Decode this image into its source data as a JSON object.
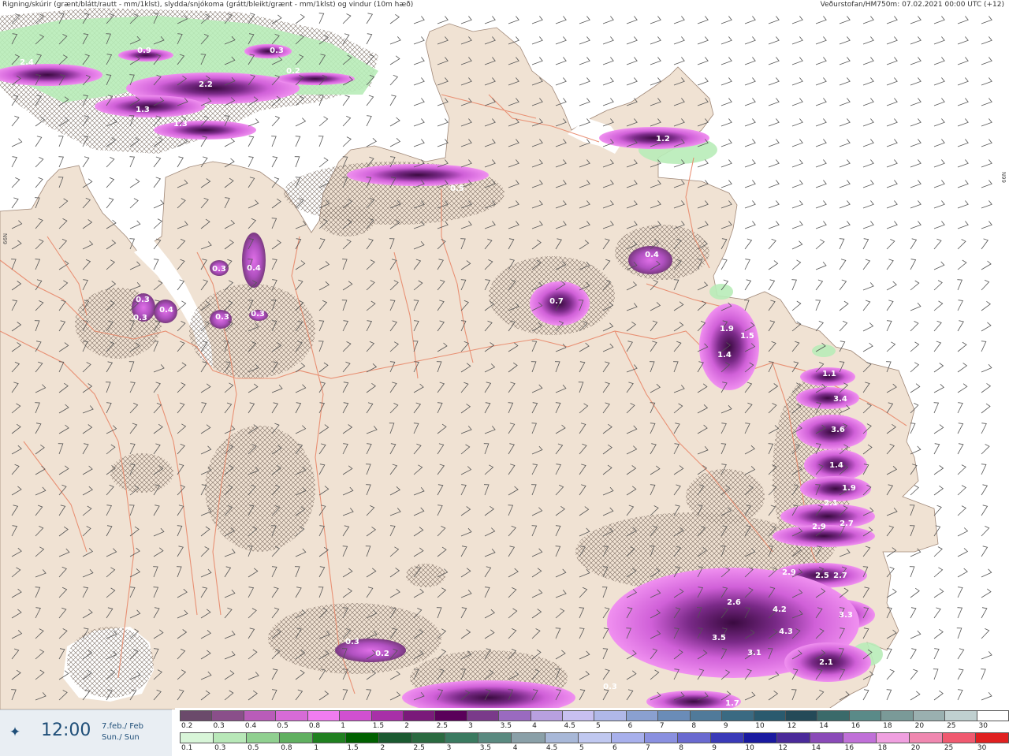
{
  "header": {
    "left_text": "Rigning/skúrir (grænt/blátt/rautt - mm/1klst), slydda/snjókoma (grátt/bleikt/grænt - mm/1klst) og vindur (10m hæð)",
    "right_text": "Veðurstofan/HM750m: 07.02.2021 00:00 UTC (+12)"
  },
  "latitude_markers": [
    "66N",
    "66N"
  ],
  "time_panel": {
    "icon": "compass-star-icon",
    "time": "12:00",
    "date_line1": "7.feb./ Feb",
    "date_line2": "Sun./ Sun"
  },
  "map": {
    "land_color": "#f0e2d3",
    "sea_color": "#ffffff",
    "road_color": "#e8886a",
    "precip_labels": [
      {
        "text": "2.4",
        "light": true
      },
      {
        "text": "0.9",
        "light": true
      },
      {
        "text": "0.3",
        "light": true
      },
      {
        "text": "0.2",
        "light": true
      },
      {
        "text": "2.2",
        "light": true
      },
      {
        "text": "1.3",
        "light": true
      },
      {
        "text": "1.3",
        "light": true
      },
      {
        "text": "0.5",
        "light": true
      },
      {
        "text": "1.2",
        "light": true
      },
      {
        "text": "0.3",
        "light": true
      },
      {
        "text": "0.4",
        "light": true
      },
      {
        "text": "0.3",
        "light": true
      },
      {
        "text": "0.4",
        "light": true
      },
      {
        "text": "0.3",
        "light": true
      },
      {
        "text": "0.3",
        "light": true
      },
      {
        "text": "0.3",
        "light": true
      },
      {
        "text": "0.4",
        "light": true
      },
      {
        "text": "0.7",
        "light": true
      },
      {
        "text": "1.9",
        "light": true
      },
      {
        "text": "1.5",
        "light": true
      },
      {
        "text": "1.4",
        "light": true
      },
      {
        "text": "1.1",
        "light": true
      },
      {
        "text": "3.4",
        "light": true
      },
      {
        "text": "3.6",
        "light": true
      },
      {
        "text": "1.4",
        "light": true
      },
      {
        "text": "1.9",
        "light": true
      },
      {
        "text": "2.1",
        "light": true
      },
      {
        "text": "2.9",
        "light": true
      },
      {
        "text": "2.7",
        "light": true
      },
      {
        "text": "2.9",
        "light": true
      },
      {
        "text": "2.5",
        "light": true
      },
      {
        "text": "2.7",
        "light": true
      },
      {
        "text": "2.6",
        "light": true
      },
      {
        "text": "4.2",
        "light": true
      },
      {
        "text": "3.3",
        "light": true
      },
      {
        "text": "3.5",
        "light": true
      },
      {
        "text": "4.3",
        "light": true
      },
      {
        "text": "3.1",
        "light": true
      },
      {
        "text": "2.1",
        "light": true
      },
      {
        "text": "0.3",
        "light": true
      },
      {
        "text": "0.2",
        "light": true
      },
      {
        "text": "0.3",
        "light": true
      },
      {
        "text": "1.7",
        "light": true
      }
    ]
  },
  "legend_rain": {
    "labels": [
      "0.2",
      "0.3",
      "0.4",
      "0.5",
      "0.8",
      "1",
      "1.5",
      "2",
      "2.5",
      "3",
      "3.5",
      "4",
      "4.5",
      "5",
      "6",
      "7",
      "8",
      "9",
      "10",
      "12",
      "14",
      "16",
      "18",
      "20",
      "25",
      "30"
    ],
    "colors": [
      "#6b4a6b",
      "#8a4f8a",
      "#b95cb9",
      "#d76bd7",
      "#f07cf0",
      "#d050d0",
      "#a830a8",
      "#7a1a7a",
      "#5a005a",
      "#7a3a8a",
      "#9a6ac0",
      "#b8a0e0",
      "#c8c0f0",
      "#b0b8e8",
      "#8aa0d0",
      "#6a8cb8",
      "#507a9a",
      "#3a6a82",
      "#2a5a6e",
      "#244a58",
      "#3a6a6a",
      "#5a8a88",
      "#7a9a98",
      "#9ab0b0",
      "#c0d0d0",
      "#ffffff"
    ]
  },
  "legend_snow": {
    "labels": [
      "0.1",
      "0.3",
      "0.5",
      "0.8",
      "1",
      "1.5",
      "2",
      "2.5",
      "3",
      "3.5",
      "4",
      "4.5",
      "5",
      "6",
      "7",
      "8",
      "9",
      "10",
      "12",
      "14",
      "16",
      "18",
      "20",
      "25",
      "30"
    ],
    "colors": [
      "#d8f5d8",
      "#b8e8b8",
      "#90d090",
      "#60b060",
      "#208020",
      "#006000",
      "#1a5a30",
      "#2a6a40",
      "#3a7a60",
      "#5a8a80",
      "#8aa0a8",
      "#a8b8d8",
      "#c0c8f0",
      "#a8b0ec",
      "#8a90e0",
      "#6a6ad0",
      "#3a3ab8",
      "#1a1aa0",
      "#4a2a9a",
      "#8a4ab8",
      "#c070d8",
      "#f0a0e0",
      "#f088b0",
      "#f05a70",
      "#e02020"
    ]
  }
}
